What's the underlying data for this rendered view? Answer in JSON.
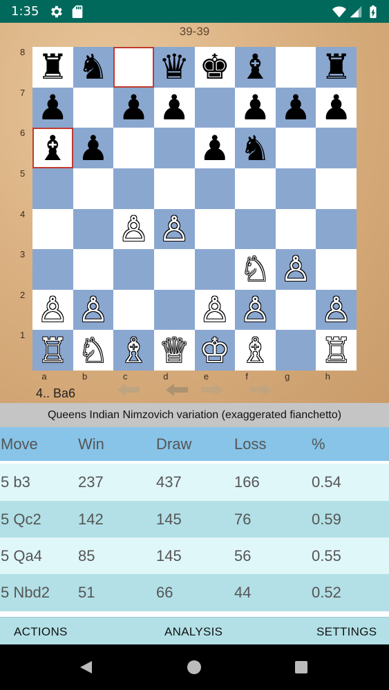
{
  "status": {
    "time": "1:35"
  },
  "header": {
    "score": "39-39"
  },
  "board": {
    "rank_labels": [
      "8",
      "7",
      "6",
      "5",
      "4",
      "3",
      "2",
      "1"
    ],
    "file_labels": [
      "a",
      "b",
      "c",
      "d",
      "e",
      "f",
      "g",
      "h"
    ],
    "pieces": [
      [
        "♜",
        "♞",
        "",
        "♛",
        "♚",
        "♝",
        "",
        "♜"
      ],
      [
        "♟",
        "",
        "♟",
        "♟",
        "",
        "♟",
        "♟",
        "♟"
      ],
      [
        "♝",
        "♟",
        "",
        "",
        "♟",
        "♞",
        "",
        ""
      ],
      [
        "",
        "",
        "",
        "",
        "",
        "",
        "",
        ""
      ],
      [
        "",
        "",
        "♙",
        "♙",
        "",
        "",
        "",
        ""
      ],
      [
        "",
        "",
        "",
        "",
        "",
        "♘",
        "♙",
        ""
      ],
      [
        "♙",
        "♙",
        "",
        "",
        "♙",
        "♙",
        "",
        "♙"
      ],
      [
        "♖",
        "♘",
        "♗",
        "♕",
        "♔",
        "♗",
        "",
        "♖"
      ]
    ],
    "colors": [
      [
        "b",
        "b",
        "",
        "b",
        "b",
        "b",
        "",
        "b"
      ],
      [
        "b",
        "",
        "b",
        "b",
        "",
        "b",
        "b",
        "b"
      ],
      [
        "b",
        "b",
        "",
        "",
        "b",
        "b",
        "",
        ""
      ],
      [
        "",
        "",
        "",
        "",
        "",
        "",
        "",
        ""
      ],
      [
        "",
        "",
        "w",
        "w",
        "",
        "",
        "",
        ""
      ],
      [
        "",
        "",
        "",
        "",
        "",
        "w",
        "w",
        ""
      ],
      [
        "w",
        "w",
        "",
        "",
        "w",
        "w",
        "",
        "w"
      ],
      [
        "w",
        "w",
        "w",
        "w",
        "w",
        "w",
        "",
        "w"
      ]
    ],
    "highlight_color": "#c0392b"
  },
  "game": {
    "last_move": "4.. Ba6"
  },
  "opening": {
    "name": "Queens Indian Nimzovich variation (exaggerated fianchetto)"
  },
  "table": {
    "headers": [
      "Move",
      "Win",
      "Draw",
      "Loss",
      "%"
    ],
    "rows": [
      [
        "5 b3",
        "237",
        "437",
        "166",
        "0.54"
      ],
      [
        "5 Qc2",
        "142",
        "145",
        "76",
        "0.59"
      ],
      [
        "5 Qa4",
        "85",
        "145",
        "56",
        "0.55"
      ],
      [
        "5 Nbd2",
        "51",
        "66",
        "44",
        "0.52"
      ]
    ]
  },
  "bottom_bar": {
    "actions": "ACTIONS",
    "analysis": "ANALYSIS",
    "settings": "SETTINGS"
  },
  "colors": {
    "status_bar": "#00695c",
    "board_dark": "#8aa7d0",
    "board_light": "#ffffff",
    "table_header": "#87c4e8",
    "row_light": "#e0f7fa",
    "row_dark": "#b2e0e6"
  }
}
